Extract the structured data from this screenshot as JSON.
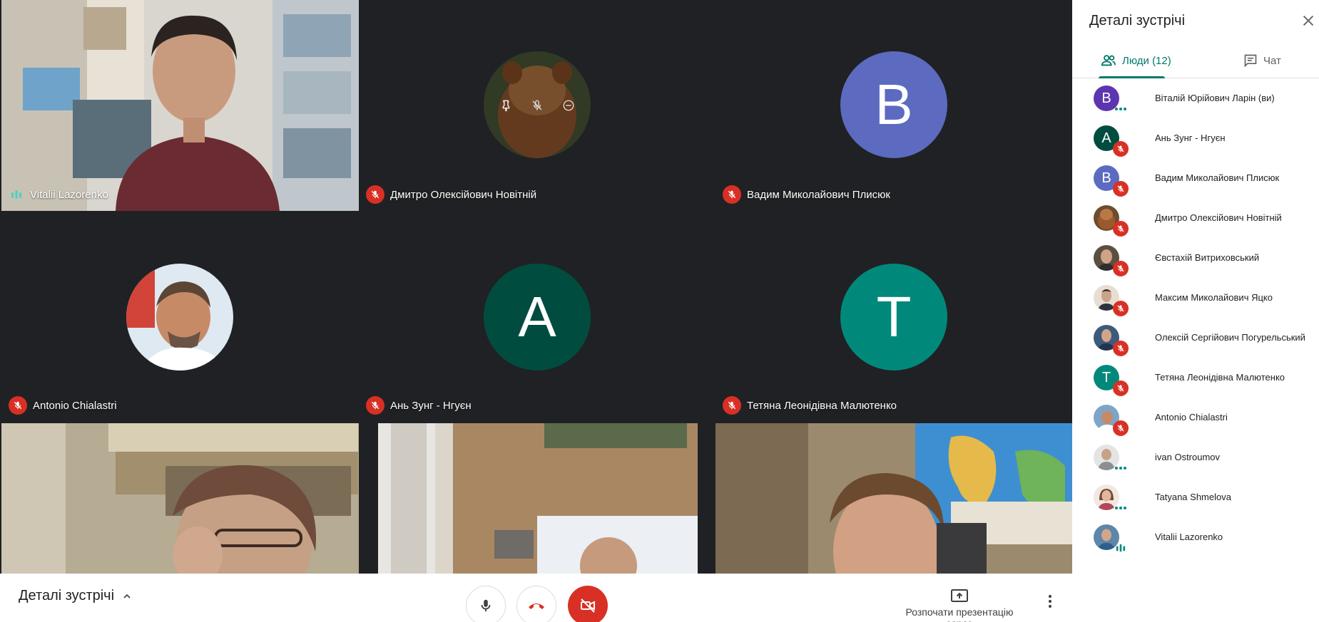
{
  "tiles": [
    {
      "name": "Vitalii Lazorenko",
      "status": "speaking"
    },
    {
      "name": "Дмитро Олексійович Новітній",
      "status": "muted"
    },
    {
      "name": "Вадим Миколайович Плисюк",
      "status": "muted",
      "initial": "В",
      "color": "#5c6bc0"
    },
    {
      "name": "Antonio Chialastri",
      "status": "muted"
    },
    {
      "name": "Ань Зунг - Нгуєн",
      "status": "muted",
      "initial": "А",
      "color": "#004d40"
    },
    {
      "name": "Тетяна Леонідівна Малютенко",
      "status": "muted",
      "initial": "Т",
      "color": "#00897b"
    }
  ],
  "bottom_bar": {
    "details_label": "Деталі зустрічі",
    "present_label": "Розпочати презентацію зараз"
  },
  "panel": {
    "title": "Деталі зустрічі",
    "tabs": {
      "people": "Люди (12)",
      "chat": "Чат"
    },
    "people": [
      {
        "name": "Віталій Юрійович Ларін (ви)",
        "initial": "В",
        "color": "#5e35b1",
        "status": "active"
      },
      {
        "name": "Ань Зунг - Нгуєн",
        "initial": "А",
        "color": "#004d40",
        "status": "muted"
      },
      {
        "name": "Вадим Миколайович Плисюк",
        "initial": "В",
        "color": "#5c6bc0",
        "status": "muted"
      },
      {
        "name": "Дмитро Олексійович Новітній",
        "photo": "#6d4c2f",
        "status": "muted"
      },
      {
        "name": "Євстахій Витриховський",
        "photo": "#5a5040",
        "status": "muted"
      },
      {
        "name": "Максим Миколайович Яцко",
        "photo": "#c9b8a4",
        "status": "muted"
      },
      {
        "name": "Олексій Сергійович Погурельський",
        "photo": "#3e5a7a",
        "status": "muted"
      },
      {
        "name": "Тетяна Леонідівна Малютенко",
        "initial": "Т",
        "color": "#00897b",
        "status": "muted"
      },
      {
        "name": "Antonio Chialastri",
        "photo": "#7fa4c8",
        "status": "muted"
      },
      {
        "name": "ivan Ostroumov",
        "photo": "#8a8f94",
        "status": "active"
      },
      {
        "name": "Tatyana Shmelova",
        "photo": "#d8c3b4",
        "status": "active"
      },
      {
        "name": "Vitalii Lazorenko",
        "photo": "#5d86a8",
        "status": "speaking"
      }
    ]
  }
}
